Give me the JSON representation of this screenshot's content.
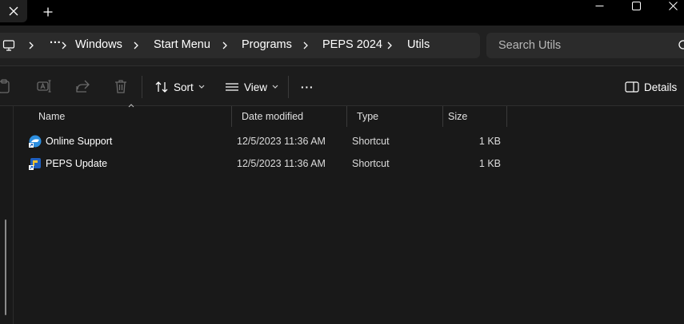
{
  "breadcrumb": {
    "items": [
      "Windows",
      "Start Menu",
      "Programs",
      "PEPS 2024",
      "Utils"
    ],
    "more": "···"
  },
  "search": {
    "placeholder": "Search Utils"
  },
  "toolbar": {
    "sort_label": "Sort",
    "view_label": "View",
    "more_label": "···",
    "details_label": "Details"
  },
  "columns": [
    "Name",
    "Date modified",
    "Type",
    "Size"
  ],
  "files": [
    {
      "name": "Online Support",
      "date": "12/5/2023 11:36 AM",
      "type": "Shortcut",
      "size": "1 KB",
      "icon": "online-support-shortcut-icon"
    },
    {
      "name": "PEPS Update",
      "date": "12/5/2023 11:36 AM",
      "type": "Shortcut",
      "size": "1 KB",
      "icon": "peps-update-shortcut-icon"
    }
  ],
  "colors": {
    "background": "#191919",
    "titlebar": "#000000",
    "addressbar": "#202020",
    "field": "#2b2b2b",
    "text": "#ffffff"
  }
}
